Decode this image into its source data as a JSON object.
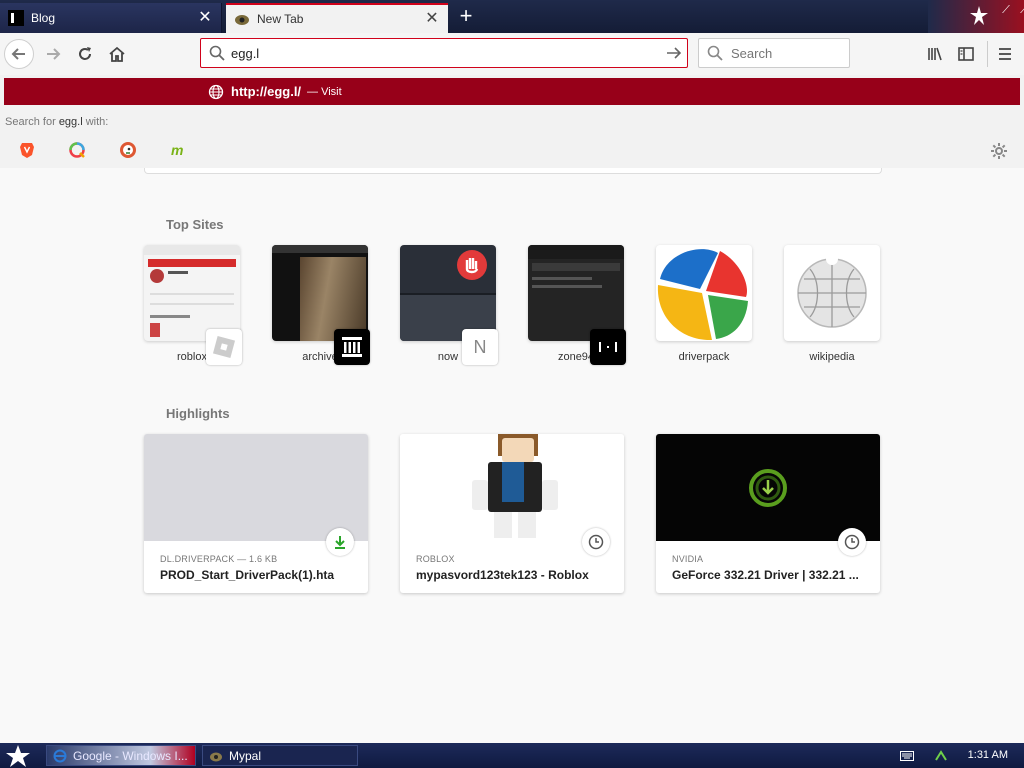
{
  "tabs": [
    {
      "label": "Blog",
      "active": false
    },
    {
      "label": "New Tab",
      "active": true
    }
  ],
  "navbar": {
    "url_value": "egg.l",
    "search_placeholder": "Search"
  },
  "dropdown": {
    "suggestion_url": "http://egg.l/",
    "suggestion_action": "— Visit",
    "search_with_prefix": "Search for",
    "search_with_term": "egg.l",
    "search_with_suffix": "with:",
    "engines": [
      "brave-icon",
      "qwant-icon",
      "duckduckgo-icon",
      "mojeek-icon"
    ]
  },
  "top_sites": {
    "title": "Top Sites",
    "items": [
      {
        "label": "roblox"
      },
      {
        "label": "archive"
      },
      {
        "label": "now",
        "badge": "N"
      },
      {
        "label": "zone94"
      },
      {
        "label": "driverpack"
      },
      {
        "label": "wikipedia"
      }
    ]
  },
  "highlights": {
    "title": "Highlights",
    "items": [
      {
        "meta": "DL.DRIVERPACK — 1.6 KB",
        "title": "PROD_Start_DriverPack(1).hta",
        "icon": "download-icon"
      },
      {
        "meta": "ROBLOX",
        "title": "mypasvord123tek123 - Roblox",
        "icon": "clock-icon"
      },
      {
        "meta": "NVIDIA",
        "title": "GeForce 332.21 Driver | 332.21 ...",
        "icon": "clock-icon"
      }
    ]
  },
  "taskbar": {
    "tasks": [
      {
        "label": "Google - Windows I..."
      },
      {
        "label": "Mypal"
      }
    ],
    "clock": "1:31 AM"
  },
  "colors": {
    "accent": "#d0021b",
    "suggestion_bg": "#970019",
    "taskbar": "#1d2a5a"
  }
}
